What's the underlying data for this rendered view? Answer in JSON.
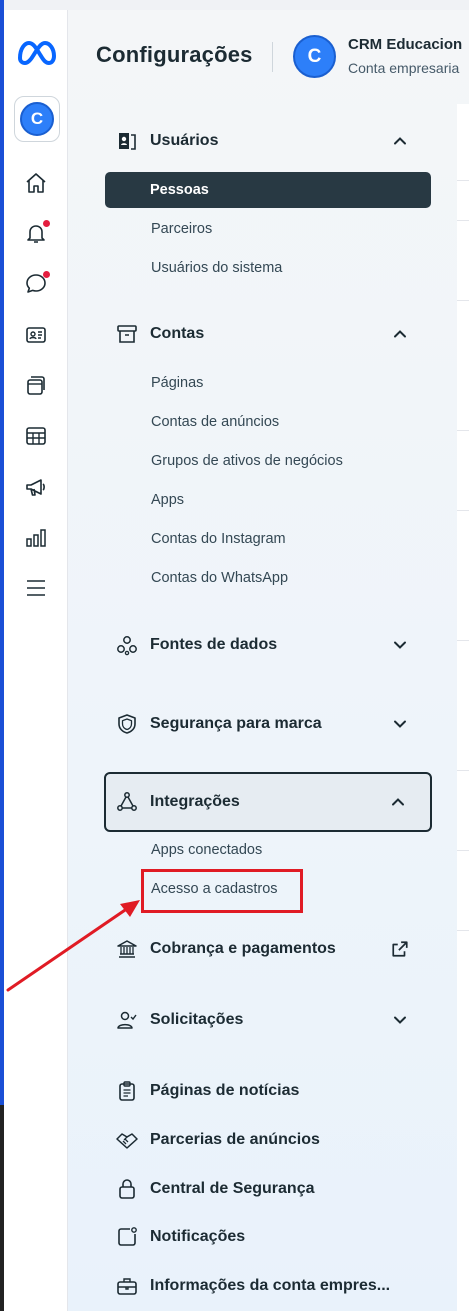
{
  "header": {
    "title": "Configurações",
    "account_initial": "C",
    "account_name": "CRM Educacion",
    "account_type": "Conta empresaria"
  },
  "rail": {
    "avatar_initial": "C",
    "icons": [
      "home-icon",
      "notifications-icon",
      "chat-icon",
      "contacts-icon",
      "content-icon",
      "table-icon",
      "megaphone-icon",
      "insights-icon",
      "menu-icon"
    ],
    "notification_dot_color": "#e41e3f"
  },
  "nav": {
    "usuarios": {
      "label": "Usuários",
      "items": [
        "Pessoas",
        "Parceiros",
        "Usuários do sistema"
      ]
    },
    "contas": {
      "label": "Contas",
      "items": [
        "Páginas",
        "Contas de anúncios",
        "Grupos de ativos de negócios",
        "Apps",
        "Contas do Instagram",
        "Contas do WhatsApp"
      ]
    },
    "fontes": {
      "label": "Fontes de dados"
    },
    "seguranca_marca": {
      "label": "Segurança para marca"
    },
    "integracoes": {
      "label": "Integrações",
      "items": [
        "Apps conectados",
        "Acesso a cadastros"
      ]
    },
    "cobranca": {
      "label": "Cobrança e pagamentos"
    },
    "solicitacoes": {
      "label": "Solicitações"
    },
    "paginas_noticias": {
      "label": "Páginas de notícias"
    },
    "parcerias": {
      "label": "Parcerias de anúncios"
    },
    "central_seguranca": {
      "label": "Central de Segurança"
    },
    "notificacoes": {
      "label": "Notificações"
    },
    "informacoes": {
      "label": "Informações da conta empres..."
    }
  },
  "colors": {
    "selected_bg": "#283943",
    "annotation_red": "#e01b24",
    "brand_blue": "#0866ff"
  }
}
